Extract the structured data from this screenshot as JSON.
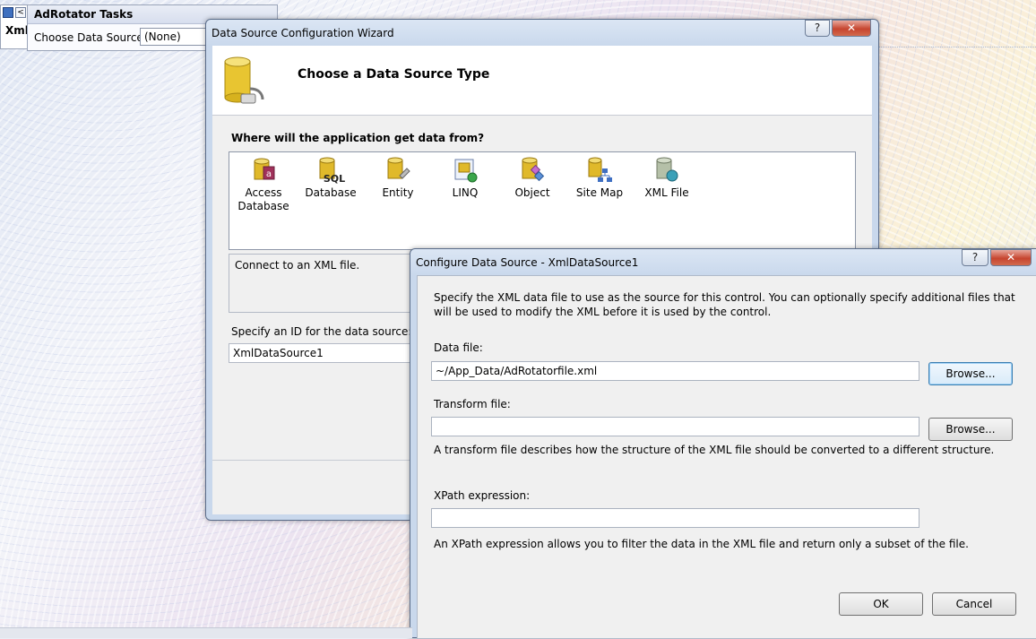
{
  "tasks_panel": {
    "tab_label": "Xml",
    "title": "AdRotator Tasks",
    "choose_label": "Choose Data Source:",
    "choose_value": "(None)"
  },
  "wizard": {
    "title": "Data Source Configuration Wizard",
    "help_button": "?",
    "close_button": "✕",
    "heading": "Choose a Data Source Type",
    "question": "Where will the application get data from?",
    "types": [
      {
        "label": "Access Database",
        "icon": "access-database-icon"
      },
      {
        "label": "Database",
        "icon": "sql-database-icon"
      },
      {
        "label": "Entity",
        "icon": "entity-icon"
      },
      {
        "label": "LINQ",
        "icon": "linq-icon"
      },
      {
        "label": "Object",
        "icon": "object-icon"
      },
      {
        "label": "Site Map",
        "icon": "site-map-icon"
      },
      {
        "label": "XML File",
        "icon": "xml-file-icon"
      }
    ],
    "selected_type": "XML File",
    "description": "Connect to an XML file.",
    "id_label": "Specify an ID for the data source:",
    "id_value": "XmlDataSource1"
  },
  "config": {
    "title": "Configure Data Source - XmlDataSource1",
    "help_button": "?",
    "close_button": "✕",
    "description": "Specify the XML data file to use as the source for this control. You can optionally specify additional files that will be used to modify the XML before it is used by the control.",
    "data_file_label": "Data file:",
    "data_file_value": "~/App_Data/AdRotatorfile.xml",
    "transform_label": "Transform file:",
    "transform_value": "",
    "transform_hint": "A transform file describes how the structure of the XML file should be converted to a different structure.",
    "xpath_label": "XPath expression:",
    "xpath_value": "",
    "xpath_hint": "An XPath expression allows you to filter the data in the XML file and return only a subset of the file.",
    "browse_label": "Browse...",
    "ok_label": "OK",
    "cancel_label": "Cancel"
  }
}
